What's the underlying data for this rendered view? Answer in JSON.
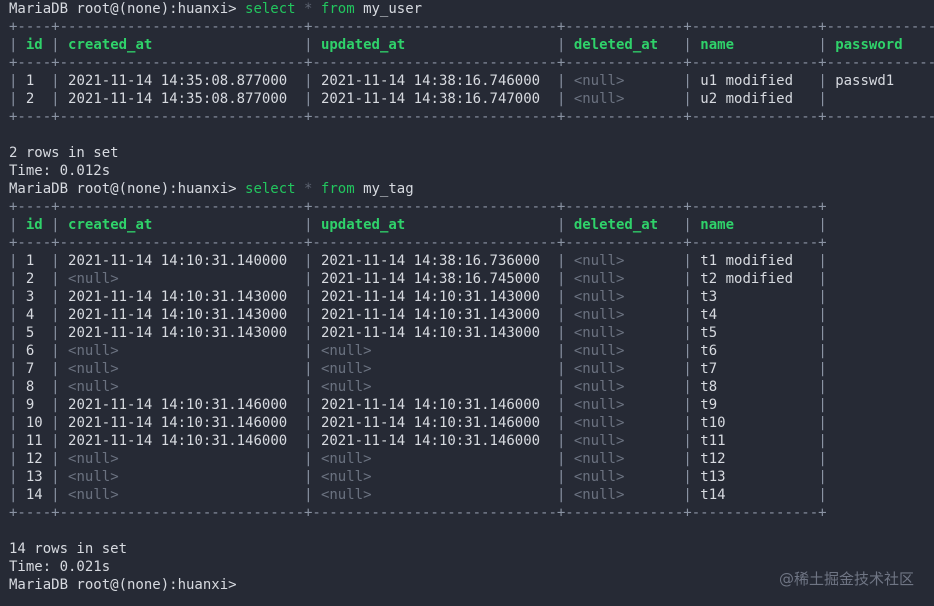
{
  "window": {
    "prompt": "MariaDB root@(none):huanxi> "
  },
  "queries": [
    {
      "keyword_select": "select",
      "star": "*",
      "keyword_from": "from",
      "table": "my_user",
      "columns": [
        "id",
        "created_at",
        "updated_at",
        "deleted_at",
        "name",
        "password"
      ],
      "rows": [
        [
          "1",
          "2021-11-14 14:35:08.877000",
          "2021-11-14 14:38:16.746000",
          "<null>",
          "u1 modified",
          "passwd1"
        ],
        [
          "2",
          "2021-11-14 14:35:08.877000",
          "2021-11-14 14:38:16.747000",
          "<null>",
          "u2 modified",
          ""
        ]
      ],
      "rows_in_set": "2 rows in set",
      "time": "Time: 0.012s"
    },
    {
      "keyword_select": "select",
      "star": "*",
      "keyword_from": "from",
      "table": "my_tag",
      "columns": [
        "id",
        "created_at",
        "updated_at",
        "deleted_at",
        "name"
      ],
      "rows": [
        [
          "1",
          "2021-11-14 14:10:31.140000",
          "2021-11-14 14:38:16.736000",
          "<null>",
          "t1 modified"
        ],
        [
          "2",
          "<null>",
          "2021-11-14 14:38:16.745000",
          "<null>",
          "t2 modified"
        ],
        [
          "3",
          "2021-11-14 14:10:31.143000",
          "2021-11-14 14:10:31.143000",
          "<null>",
          "t3"
        ],
        [
          "4",
          "2021-11-14 14:10:31.143000",
          "2021-11-14 14:10:31.143000",
          "<null>",
          "t4"
        ],
        [
          "5",
          "2021-11-14 14:10:31.143000",
          "2021-11-14 14:10:31.143000",
          "<null>",
          "t5"
        ],
        [
          "6",
          "<null>",
          "<null>",
          "<null>",
          "t6"
        ],
        [
          "7",
          "<null>",
          "<null>",
          "<null>",
          "t7"
        ],
        [
          "8",
          "<null>",
          "<null>",
          "<null>",
          "t8"
        ],
        [
          "9",
          "2021-11-14 14:10:31.146000",
          "2021-11-14 14:10:31.146000",
          "<null>",
          "t9"
        ],
        [
          "10",
          "2021-11-14 14:10:31.146000",
          "2021-11-14 14:10:31.146000",
          "<null>",
          "t10"
        ],
        [
          "11",
          "2021-11-14 14:10:31.146000",
          "2021-11-14 14:10:31.146000",
          "<null>",
          "t11"
        ],
        [
          "12",
          "<null>",
          "<null>",
          "<null>",
          "t12"
        ],
        [
          "13",
          "<null>",
          "<null>",
          "<null>",
          "t13"
        ],
        [
          "14",
          "<null>",
          "<null>",
          "<null>",
          "t14"
        ]
      ],
      "rows_in_set": "14 rows in set",
      "time": "Time: 0.021s"
    }
  ],
  "watermark": "@稀土掘金技术社区",
  "colors": {
    "background": "#262a35",
    "keyword": "#22c55e",
    "header": "#2fd26a",
    "null": "#6b7280",
    "text": "#d7dae0",
    "border": "#8a93a3"
  }
}
